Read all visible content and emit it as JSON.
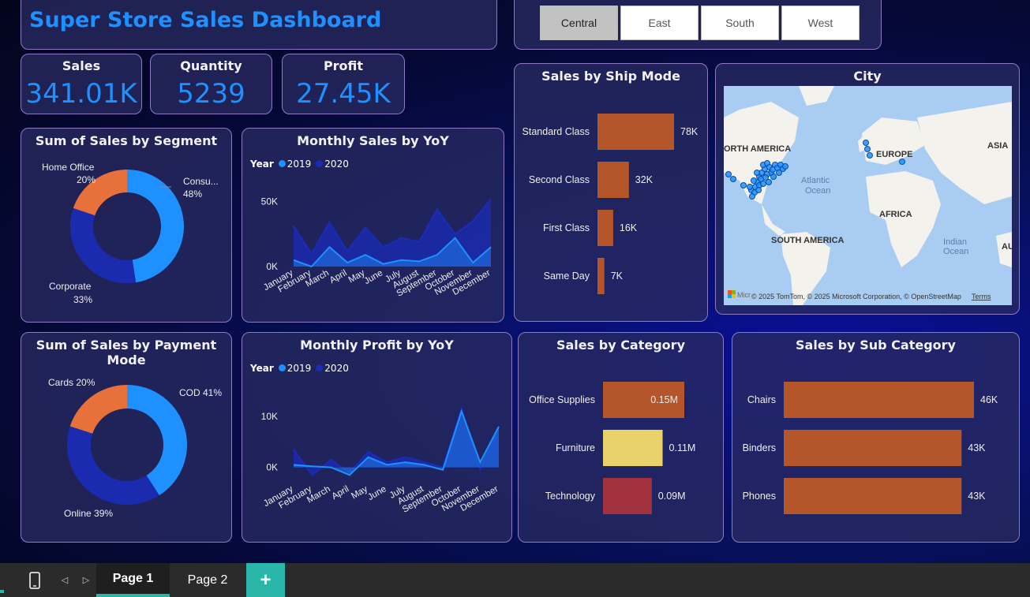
{
  "header": {
    "title": "Super Store Sales Dashboard"
  },
  "region_slicer": {
    "options": [
      "Central",
      "East",
      "South",
      "West"
    ],
    "selected": "Central"
  },
  "kpis": [
    {
      "label": "Sales",
      "value": "341.01K"
    },
    {
      "label": "Quantity",
      "value": "5239"
    },
    {
      "label": "Profit",
      "value": "27.45K"
    }
  ],
  "colors": {
    "accent": "#1e90ff",
    "series_2019": "#1e90ff",
    "series_2020": "#1a2bb8",
    "bar_orange": "#b5552a",
    "bar_yellow": "#e8d36a",
    "bar_red": "#a3323f",
    "donut_orange": "#e8703a",
    "donut_light": "#1e90ff",
    "donut_dark": "#1a2bb0"
  },
  "segment_chart": {
    "title": "Sum of Sales by Segment",
    "chart_data": {
      "type": "pie",
      "slices": [
        {
          "label": "Consu...",
          "pct": "48%",
          "value": 48
        },
        {
          "label": "Corporate",
          "pct": "33%",
          "value": 33
        },
        {
          "label": "Home Office",
          "pct": "20%",
          "value": 20
        }
      ]
    }
  },
  "monthly_sales": {
    "title": "Monthly Sales by YoY",
    "legend_title": "Year",
    "chart_data": {
      "type": "area",
      "categories": [
        "January",
        "February",
        "March",
        "April",
        "May",
        "June",
        "July",
        "August",
        "September",
        "October",
        "November",
        "December"
      ],
      "series": [
        {
          "name": "2019",
          "values": [
            5000,
            0,
            15000,
            3000,
            9000,
            2000,
            5000,
            4000,
            9000,
            22000,
            3000,
            15000
          ]
        },
        {
          "name": "2020",
          "values": [
            31000,
            10000,
            34000,
            12000,
            30000,
            15000,
            22000,
            19000,
            44000,
            25000,
            35000,
            52000
          ]
        }
      ],
      "yticks": [
        "50K",
        "0K"
      ],
      "ylim": [
        0,
        60000
      ]
    }
  },
  "ship_mode": {
    "title": "Sales by Ship Mode",
    "chart_data": {
      "type": "bar",
      "categories": [
        "Standard Class",
        "Second Class",
        "First Class",
        "Same Day"
      ],
      "values": [
        78,
        32,
        16,
        7
      ],
      "labels": [
        "78K",
        "32K",
        "16K",
        "7K"
      ]
    }
  },
  "city_map": {
    "title": "City",
    "labels": {
      "north_america": "ORTH AMERICA",
      "europe": "EUROPE",
      "asia": "ASIA",
      "atlantic": "Atlantic",
      "ocean": "Ocean",
      "africa": "AFRICA",
      "south_america": "SOUTH AMERICA",
      "indian": "Indian",
      "indian_ocean": "Ocean",
      "au": "AU"
    },
    "attribution": "© 2025 TomTom, © 2025 Microsoft Corporation, © OpenStreetMap",
    "terms": "Terms",
    "logo_text": "Micr"
  },
  "payment_chart": {
    "title": "Sum of Sales by Payment Mode",
    "chart_data": {
      "type": "pie",
      "slices": [
        {
          "label": "COD 41%",
          "value": 41
        },
        {
          "label": "Online 39%",
          "value": 39
        },
        {
          "label": "Cards 20%",
          "value": 20
        }
      ]
    }
  },
  "monthly_profit": {
    "title": "Monthly Profit by YoY",
    "legend_title": "Year",
    "chart_data": {
      "type": "area",
      "categories": [
        "January",
        "February",
        "March",
        "April",
        "May",
        "June",
        "July",
        "August",
        "September",
        "October",
        "November",
        "December"
      ],
      "series": [
        {
          "name": "2019",
          "values": [
            500,
            200,
            0,
            -1500,
            2000,
            500,
            1000,
            500,
            -500,
            11000,
            1000,
            8000
          ]
        },
        {
          "name": "2020",
          "values": [
            3500,
            -1500,
            1500,
            -1000,
            3000,
            1000,
            2000,
            1000,
            0,
            11500,
            -500,
            8000
          ]
        }
      ],
      "yticks": [
        "10K",
        "0K"
      ],
      "ylim": [
        -3000,
        14000
      ]
    }
  },
  "category_chart": {
    "title": "Sales by Category",
    "chart_data": {
      "type": "bar",
      "categories": [
        "Office Supplies",
        "Furniture",
        "Technology"
      ],
      "values": [
        0.15,
        0.11,
        0.09
      ],
      "labels": [
        "0.15M",
        "0.11M",
        "0.09M"
      ]
    }
  },
  "subcategory_chart": {
    "title": "Sales by Sub Category",
    "chart_data": {
      "type": "bar",
      "categories": [
        "Chairs",
        "Binders",
        "Phones"
      ],
      "values": [
        46,
        43,
        43
      ],
      "labels": [
        "46K",
        "43K",
        "43K"
      ]
    }
  },
  "pages": {
    "tabs": [
      "Page 1",
      "Page 2"
    ],
    "active": "Page 1",
    "add_label": "+"
  }
}
